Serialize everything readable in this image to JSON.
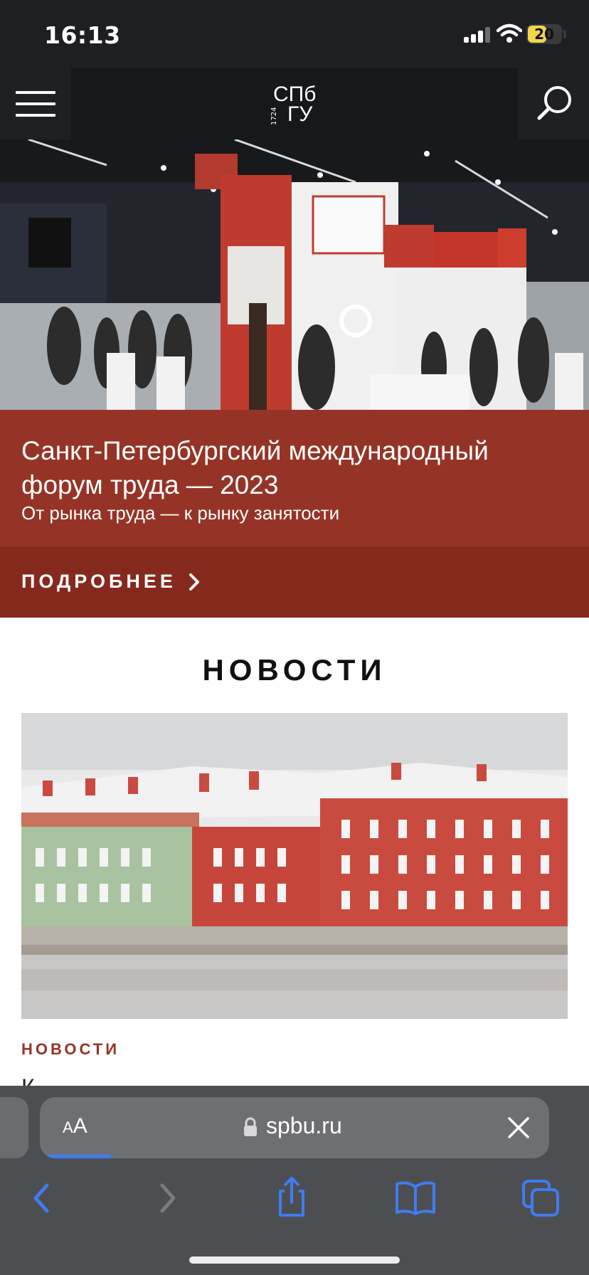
{
  "status_bar": {
    "time": "16:13",
    "battery": "20"
  },
  "header": {
    "logo_top": "СПб",
    "logo_bottom": "ГУ",
    "logo_year": "1724",
    "menu_icon": "hamburger-icon",
    "search_icon": "search-icon"
  },
  "hero": {
    "title": "Санкт-Петербургский международный форум труда — 2023",
    "subtitle": "От рынка труда — к рынку занятости",
    "more_label": "ПОДРОБНЕЕ",
    "panel_color": "#953426",
    "more_color": "#86291d"
  },
  "news": {
    "heading": "НОВОСТИ",
    "category": "НОВОСТИ",
    "cut_text": "К"
  },
  "browser": {
    "aa_small": "A",
    "aa_big": "A",
    "url": "spbu.ru",
    "load_progress": 0.14,
    "accent": "#3f7cf0",
    "icons": [
      "back-icon",
      "forward-icon",
      "share-icon",
      "bookmarks-icon",
      "tabs-icon"
    ]
  }
}
